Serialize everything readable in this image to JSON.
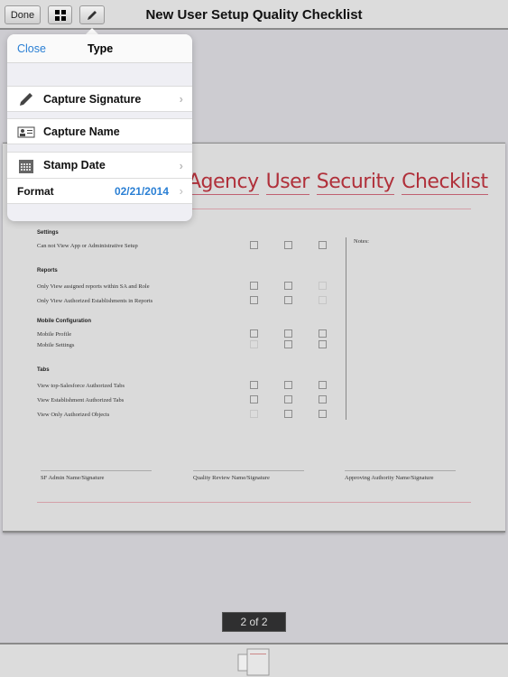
{
  "toolbar": {
    "done_label": "Done",
    "title": "New User Setup Quality Checklist",
    "grid_icon": "grid-icon",
    "pen_icon": "pencil-icon"
  },
  "popover": {
    "close_label": "Close",
    "title": "Type",
    "items": [
      {
        "label": "Capture Signature",
        "icon": "pencil-icon"
      },
      {
        "label": "Capture Name",
        "icon": "id-card-icon"
      },
      {
        "label": "Stamp Date",
        "icon": "calendar-icon"
      }
    ],
    "format_label": "Format",
    "format_value": "02/21/2014",
    "accent": "#2a7fd4"
  },
  "document": {
    "title_words": [
      "Agency",
      "User",
      "Security",
      "Checklist"
    ],
    "title_color": "#b0303a",
    "sections": [
      {
        "heading": "Settings",
        "items": [
          {
            "label": "Can not View App or Administrative Setup",
            "faded": [
              false,
              false,
              false
            ]
          }
        ]
      },
      {
        "heading": "Reports",
        "items": [
          {
            "label": "Only View assigned reports within SA and Role",
            "faded": [
              false,
              false,
              true
            ]
          },
          {
            "label": "Only View Authorized Establishments in Reports",
            "faded": [
              false,
              false,
              true
            ]
          }
        ]
      },
      {
        "heading": "Mobile Configuration",
        "items": [
          {
            "label": "Mobile Profile",
            "faded": [
              false,
              false,
              false
            ]
          },
          {
            "label": "Mobile Settings",
            "faded": [
              true,
              false,
              false
            ]
          }
        ]
      },
      {
        "heading": "Tabs",
        "items": [
          {
            "label": "View top-Salesforce Authorized Tabs",
            "faded": [
              false,
              false,
              false
            ]
          },
          {
            "label": "View Establishment Authorized Tabs",
            "faded": [
              false,
              false,
              false
            ]
          },
          {
            "label": "View Only Authorized Objects",
            "faded": [
              true,
              false,
              false
            ]
          }
        ]
      }
    ],
    "notes_label": "Notes:",
    "signatures": [
      "SF Admin Name/Signature",
      "Quality Review Name/Signature",
      "Approving Authority Name/Signature"
    ]
  },
  "pager": {
    "text": "2 of 2"
  }
}
